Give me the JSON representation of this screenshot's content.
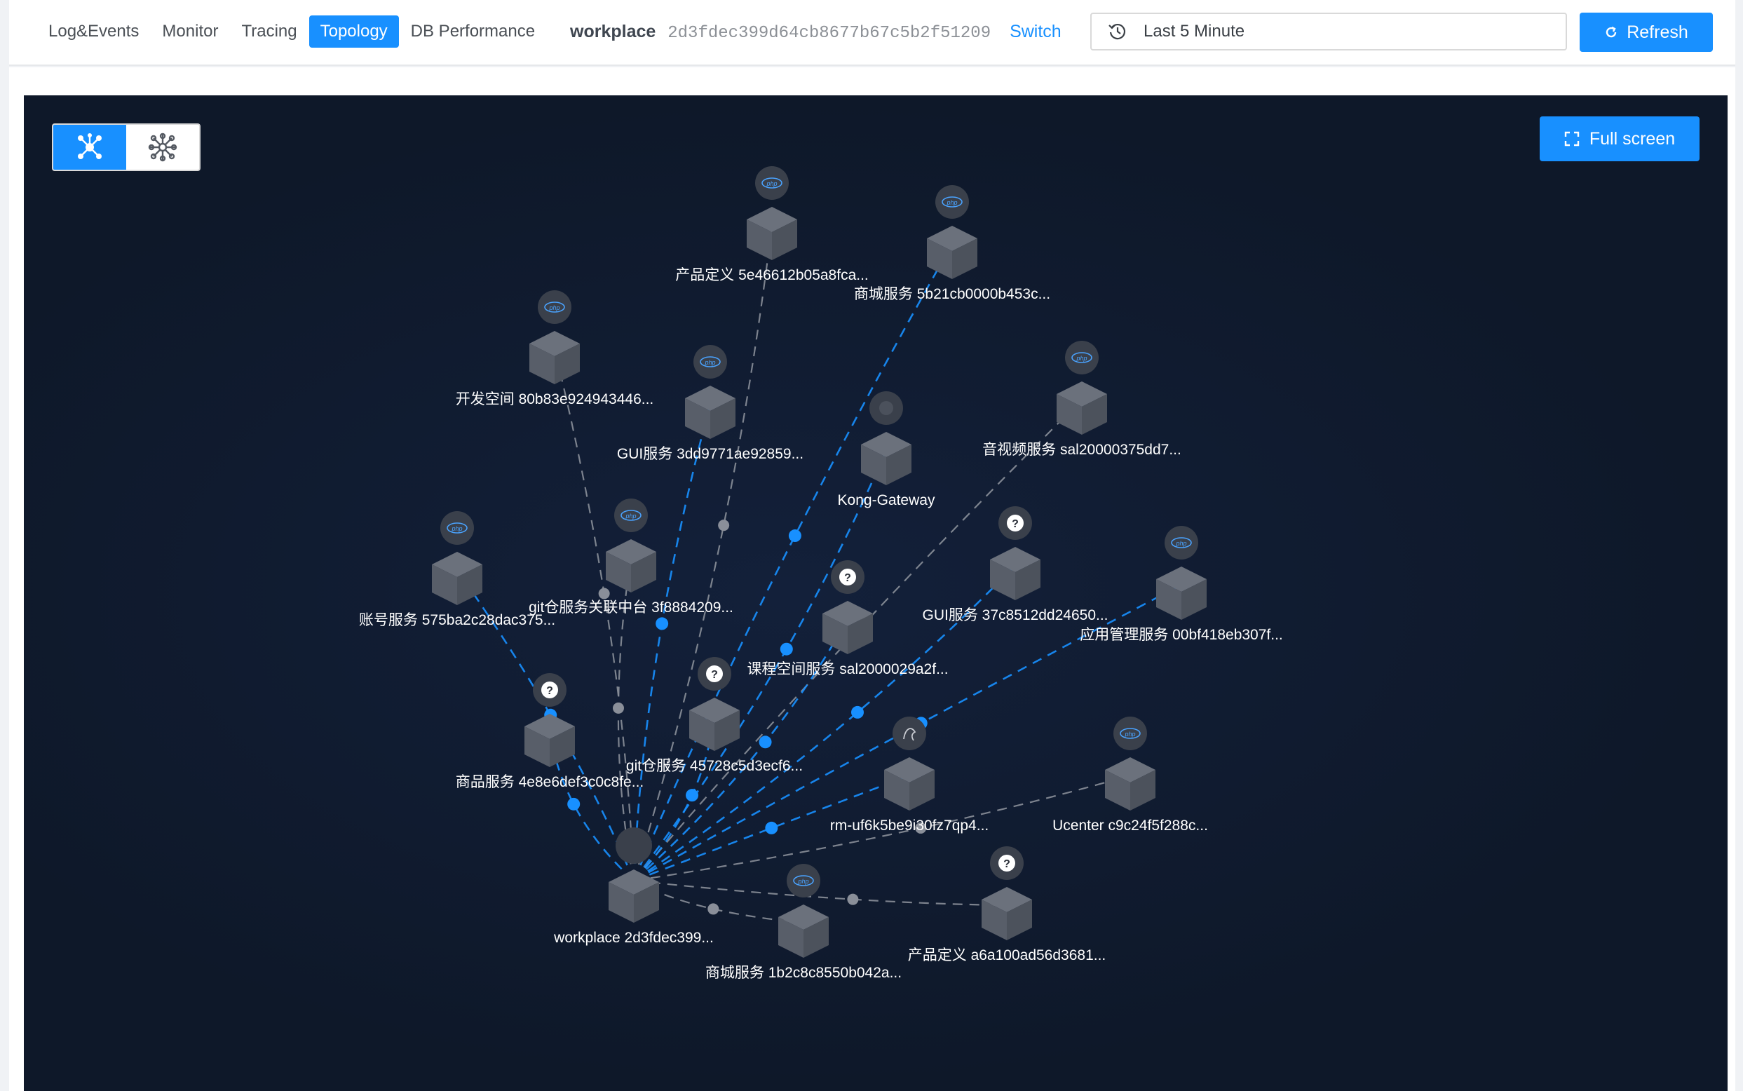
{
  "nav": {
    "items": [
      {
        "label": "Log&Events",
        "active": false
      },
      {
        "label": "Monitor",
        "active": false
      },
      {
        "label": "Tracing",
        "active": false
      },
      {
        "label": "Topology",
        "active": true
      },
      {
        "label": "DB Performance",
        "active": false
      }
    ]
  },
  "workspace": {
    "name": "workplace",
    "id": "2d3fdec399d64cb8677b67c5b2f51209",
    "switch_label": "Switch"
  },
  "time_range": {
    "label": "Last 5 Minute",
    "icon": "history-icon"
  },
  "refresh_label": "Refresh",
  "fullscreen_label": "Full screen",
  "view_toggle": [
    {
      "icon": "topology-star-icon",
      "active": true
    },
    {
      "icon": "snowflake-cluster-icon",
      "active": false
    }
  ],
  "colors": {
    "accent": "#1890ff",
    "canvas": "#0f1a2e",
    "edge_gray": "#8a8f99",
    "node": "#5d6370"
  },
  "topology": {
    "hub": "workplace 2d3fdec399...",
    "nodes": [
      {
        "id": "n1",
        "label": "产品定义 5e46612b05a8fca...",
        "badge": "php"
      },
      {
        "id": "n2",
        "label": "商城服务 5b21cb0000b453c...",
        "badge": "php"
      },
      {
        "id": "n3",
        "label": "开发空间 80b83e924943446...",
        "badge": "php"
      },
      {
        "id": "n4",
        "label": "GUI服务 3dd9771ae92859...",
        "badge": "php"
      },
      {
        "id": "n5",
        "label": "Kong-Gateway",
        "badge": "gateway"
      },
      {
        "id": "n6",
        "label": "音视频服务 sal20000375dd7...",
        "badge": "php"
      },
      {
        "id": "n7",
        "label": "账号服务 575ba2c28dac375...",
        "badge": "php"
      },
      {
        "id": "n8",
        "label": "git仓服务关联中台 3f8884209...",
        "badge": "php"
      },
      {
        "id": "n9",
        "label": "GUI服务 37c8512dd24650...",
        "badge": "unknown"
      },
      {
        "id": "n10",
        "label": "应用管理服务 00bf418eb307f...",
        "badge": "php"
      },
      {
        "id": "n11",
        "label": "课程空间服务 sal2000029a2f...",
        "badge": "unknown"
      },
      {
        "id": "n12",
        "label": "商品服务 4e8e6def3c0c8fe...",
        "badge": "unknown"
      },
      {
        "id": "n13",
        "label": "git仓服务 45728c5d3ecf6...",
        "badge": "unknown"
      },
      {
        "id": "n14",
        "label": "rm-uf6k5be9i30fz7qp4...",
        "badge": "mysql"
      },
      {
        "id": "n15",
        "label": "Ucenter c9c24f5f288c...",
        "badge": "php"
      },
      {
        "id": "n16",
        "label": "商城服务 1b2c8c8550b042a...",
        "badge": "php"
      },
      {
        "id": "n17",
        "label": "产品定义 a6a100ad56d3681...",
        "badge": "unknown"
      }
    ]
  }
}
